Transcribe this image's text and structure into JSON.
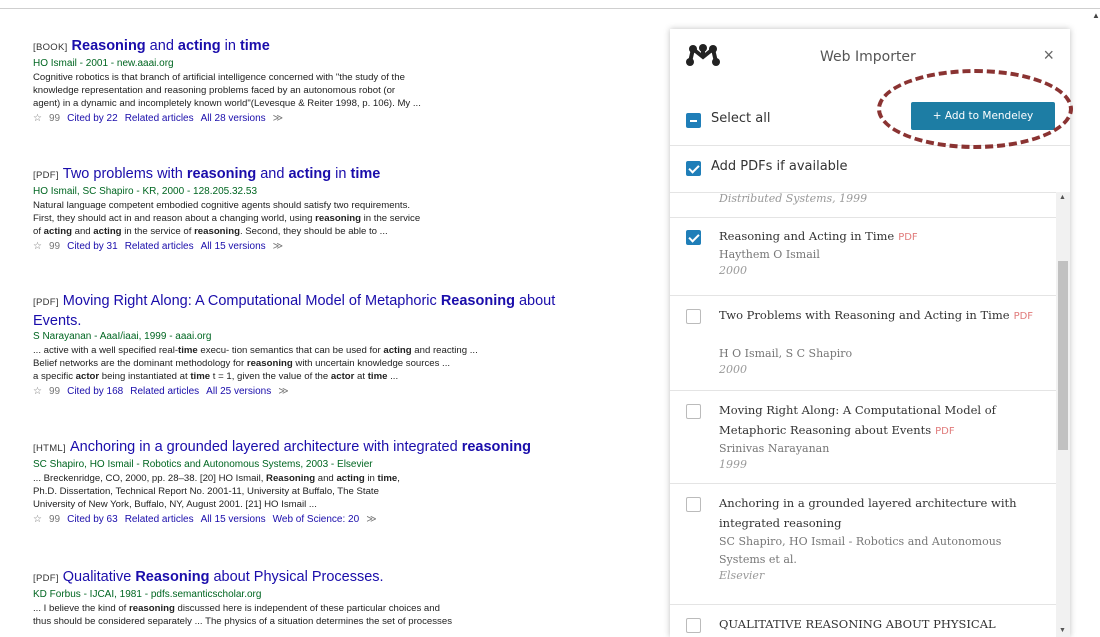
{
  "results": [
    {
      "kind": "[BOOK]",
      "title_parts": [
        [
          "Reasoning",
          true
        ],
        [
          " and ",
          false
        ],
        [
          "acting",
          true
        ],
        [
          " in ",
          false
        ],
        [
          "time",
          true
        ]
      ],
      "authors": "HO Ismail - 2001 - new.aaai.org",
      "snippet": [
        [
          [
            "Cognitive robotics is that branch of artificial intelligence concerned with \"the study of the",
            false
          ]
        ],
        [
          [
            "knowledge representation and reasoning problems faced by an autonomous robot (or",
            false
          ]
        ],
        [
          [
            "agent) in a dynamic and incompletely known world\"(Levesque & Reiter 1998, p. 106). My ...",
            false
          ]
        ]
      ],
      "links": [
        "Cited by 22",
        "Related articles",
        "All 28 versions"
      ]
    },
    {
      "kind": "[PDF]",
      "title_parts": [
        [
          "Two problems with ",
          false
        ],
        [
          "reasoning",
          true
        ],
        [
          " and ",
          false
        ],
        [
          "acting",
          true
        ],
        [
          " in ",
          false
        ],
        [
          "time",
          true
        ]
      ],
      "authors": "HO Ismail, SC Shapiro - KR, 2000 - 128.205.32.53",
      "snippet": [
        [
          [
            "Natural language competent embodied cognitive agents should satisfy two requirements.",
            false
          ]
        ],
        [
          [
            "First, they should act in and reason about a changing world, using ",
            false
          ],
          [
            "reasoning",
            true
          ],
          [
            " in the service",
            false
          ]
        ],
        [
          [
            "of ",
            false
          ],
          [
            "acting",
            true
          ],
          [
            " and ",
            false
          ],
          [
            "acting",
            true
          ],
          [
            " in the service of ",
            false
          ],
          [
            "reasoning",
            true
          ],
          [
            ". Second, they should be able to ...",
            false
          ]
        ]
      ],
      "links": [
        "Cited by 31",
        "Related articles",
        "All 15 versions"
      ]
    },
    {
      "kind": "[PDF]",
      "title_parts": [
        [
          "Moving Right Along: A Computational Model of Metaphoric ",
          false
        ],
        [
          "Reasoning",
          true
        ],
        [
          " about",
          false
        ]
      ],
      "title_line2": "Events.",
      "authors": "S Narayanan - AaaI/iaai, 1999 - aaai.org",
      "snippet": [
        [
          [
            "... active with a well specified real-",
            false
          ],
          [
            "time",
            true
          ],
          [
            " execu- tion semantics that can be used for ",
            false
          ],
          [
            "acting",
            true
          ],
          [
            " and reacting ...",
            false
          ]
        ],
        [
          [
            "Belief networks are the dominant methodology for ",
            false
          ],
          [
            "reasoning",
            true
          ],
          [
            " with uncertain knowledge sources ...",
            false
          ]
        ],
        [
          [
            "a specific ",
            false
          ],
          [
            "actor",
            true
          ],
          [
            " being instantiated at ",
            false
          ],
          [
            "time",
            true
          ],
          [
            " t = 1, given the value of the ",
            false
          ],
          [
            "actor",
            true
          ],
          [
            " at ",
            false
          ],
          [
            "time",
            true
          ],
          [
            " ...",
            false
          ]
        ]
      ],
      "links": [
        "Cited by 168",
        "Related articles",
        "All 25 versions"
      ]
    },
    {
      "kind": "[HTML]",
      "title_parts": [
        [
          "Anchoring in a grounded layered architecture with integrated ",
          false
        ],
        [
          "reasoning",
          true
        ]
      ],
      "authors": "SC Shapiro, HO Ismail - Robotics and Autonomous Systems, 2003 - Elsevier",
      "snippet": [
        [
          [
            "... Breckenridge, CO, 2000, pp. 28–38. [20] HO Ismail, ",
            false
          ],
          [
            "Reasoning",
            true
          ],
          [
            " and ",
            false
          ],
          [
            "acting",
            true
          ],
          [
            " in ",
            false
          ],
          [
            "time",
            true
          ],
          [
            ",",
            false
          ]
        ],
        [
          [
            "Ph.D. Dissertation, Technical Report No. 2001-11, University at Buffalo, The State",
            false
          ]
        ],
        [
          [
            "University of New York, Buffalo, NY, August 2001. [21] HO Ismail ...",
            false
          ]
        ]
      ],
      "links": [
        "Cited by 63",
        "Related articles",
        "All 15 versions",
        "Web of Science: 20"
      ]
    },
    {
      "kind": "[PDF]",
      "title_parts": [
        [
          "Qualitative ",
          false
        ],
        [
          "Reasoning",
          true
        ],
        [
          " about Physical Processes.",
          false
        ]
      ],
      "authors": "KD Forbus - IJCAI, 1981 - pdfs.semanticscholar.org",
      "snippet": [
        [
          [
            "... I believe the kind of ",
            false
          ],
          [
            "reasoning",
            true
          ],
          [
            " discussed here is independent of these particular choices and",
            false
          ]
        ],
        [
          [
            "thus should be considered separately ... The physics of a situation determines the set of processes",
            false
          ]
        ]
      ],
      "links": []
    }
  ],
  "icons": {
    "star": "☆",
    "cite": "99",
    "more": "≫"
  },
  "panel": {
    "title": "Web Importer",
    "close": "×",
    "select_all": "Select all",
    "add_button": "+ Add to Mendeley",
    "add_pdfs": "Add PDFs if available",
    "prev_fragment": "Distributed Systems, 1999",
    "pdf_tag": "PDF",
    "items": [
      {
        "checked": true,
        "title": "Reasoning and Acting in Time",
        "pdf": true,
        "authors": "Haythem O Ismail",
        "year": "2000"
      },
      {
        "checked": false,
        "title": "Two Problems with Reasoning and Acting in Time",
        "pdf": true,
        "authors": "H O Ismail, S C Shapiro",
        "year": "2000"
      },
      {
        "checked": false,
        "title": "Moving Right Along: A Computational Model of Metaphoric Reasoning about Events",
        "pdf": true,
        "authors": "Srinivas Narayanan",
        "year": "1999"
      },
      {
        "checked": false,
        "title": "Anchoring in a grounded layered architecture with integrated reasoning",
        "pdf": false,
        "authors": "SC Shapiro, HO Ismail - Robotics and Autonomous Systems et al.",
        "year": "Elsevier"
      },
      {
        "checked": false,
        "title": "QUALITATIVE REASONING ABOUT PHYSICAL",
        "pdf": false,
        "authors": "",
        "year": ""
      }
    ]
  },
  "colors": {
    "link": "#1a0dab",
    "author": "#006621",
    "button": "#1d7da4",
    "checkbox": "#1f7eb8",
    "annotation": "#8a3332",
    "pdf_tag": "#e07a7a"
  }
}
